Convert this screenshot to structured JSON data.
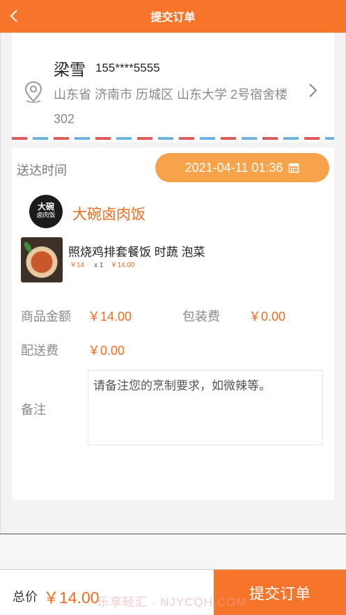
{
  "header": {
    "title": "提交订单"
  },
  "address": {
    "name": "梁雪",
    "phone": "155****5555",
    "detail": "山东省 济南市 历城区 山东大学 2号宿舍楼302"
  },
  "delivery": {
    "label": "送达时间",
    "time": "2021-04-11 01:36"
  },
  "shop": {
    "logo_line1": "大碗",
    "logo_line2": "卤肉饭",
    "name": "大碗卤肉饭"
  },
  "item": {
    "name": "照烧鸡排套餐饭 时蔬 泡菜",
    "unit_price": "￥14",
    "quantity": "x 1",
    "subtotal": "￥14.00"
  },
  "fees": {
    "goods_label": "商品金额",
    "goods_value": "￥14.00",
    "packing_label": "包装费",
    "packing_value": "￥0.00",
    "delivery_label": "配送费",
    "delivery_value": "￥0.00"
  },
  "remark": {
    "label": "备注",
    "placeholder": "请备注您的烹制要求，如微辣等。"
  },
  "footer": {
    "total_label": "总价",
    "total_value": "￥14.00",
    "submit_label": "提交订单"
  },
  "watermark": "乐享轻汇 · NJYCQH.COM",
  "colors": {
    "accent": "#f7752b",
    "price": "#f26b1d",
    "pill": "#f7a34b"
  }
}
